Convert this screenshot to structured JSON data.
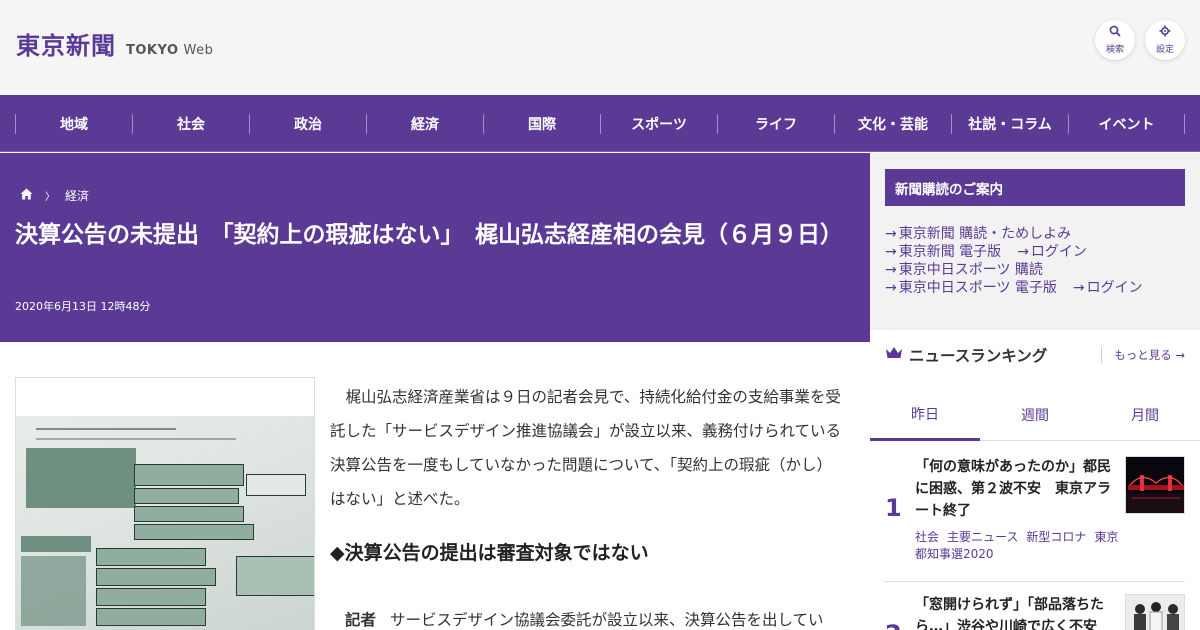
{
  "header": {
    "logo": "東京新聞",
    "logo_sub": "TOKYO",
    "logo_web": "Web",
    "search_icon": "search-icon",
    "search_label": "検索",
    "settings_icon": "gear-icon",
    "settings_label": "設定"
  },
  "nav": {
    "items": [
      "地域",
      "社会",
      "政治",
      "経済",
      "国際",
      "スポーツ",
      "ライフ",
      "文化・芸能",
      "社説・コラム",
      "イベント"
    ]
  },
  "article": {
    "breadcrumb_home_icon": "home-icon",
    "breadcrumb_category": "経済",
    "title": "決算公告の未提出　「契約上の瑕疵はない」　梶山弘志経産相の会見（６月９日）",
    "date": "2020年6月13日 12時48分",
    "lead": "梶山弘志経済産業省は９日の記者会見で、持続化給付金の支給事業を受託した「サービスデザイン推進協議会」が設立以来、義務付けられている決算公告を一度もしていなかった問題について、「契約上の瑕疵（かし）はない」と述べた。",
    "heading": "◆決算公告の提出は審査対象ではない",
    "qa_speaker": "記者",
    "qa_text": "サービスデザイン協議会委託が設立以来、決算公告を出してい"
  },
  "sidebar": {
    "subscribe_title": "新聞購読のご案内",
    "links": {
      "row1": "東京新聞 購読・ためしよみ",
      "row2a": "東京新聞 電子版",
      "row2b": "ログイン",
      "row3": "東京中日スポーツ 購読",
      "row4a": "東京中日スポーツ 電子版",
      "row4b": "ログイン"
    },
    "ranking_title": "ニュースランキング",
    "more": "もっと見る",
    "tabs": [
      "昨日",
      "週間",
      "月間"
    ],
    "items": [
      {
        "rank": "1",
        "text": "「何の意味があったのか」都民に困惑、第２波不安　東京アラート終了",
        "tags": [
          "社会",
          "主要ニュース",
          "新型コロナ",
          "東京都知事選2020"
        ]
      },
      {
        "rank": "2",
        "text": "「窓開けられず」「部品落ちたら…」渋谷や川崎で広く不安"
      }
    ]
  },
  "colors": {
    "brand": "#5b3a96",
    "header_bg": "#f5f5f5"
  }
}
